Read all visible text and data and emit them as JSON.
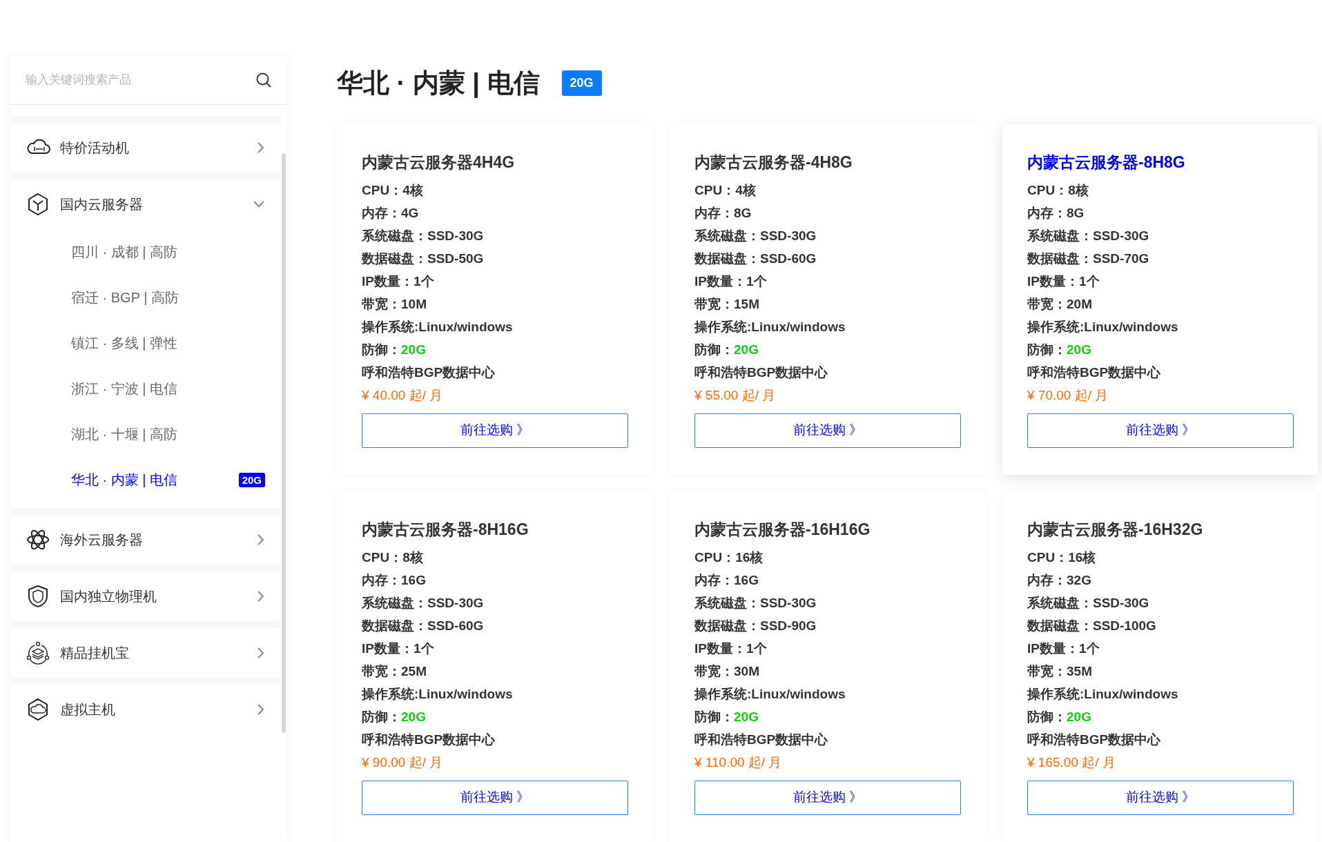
{
  "sidebar": {
    "search": {
      "placeholder": "输入关键词搜索产品"
    },
    "categories": [
      {
        "label": "特价活动机",
        "expanded": false
      },
      {
        "label": "国内云服务器",
        "expanded": true,
        "children": [
          {
            "label": "四川 · 成都 | 高防",
            "selected": false
          },
          {
            "label": "宿迁 · BGP | 高防",
            "selected": false
          },
          {
            "label": "镇江 · 多线 | 弹性",
            "selected": false
          },
          {
            "label": "浙江 · 宁波 | 电信",
            "selected": false
          },
          {
            "label": "湖北 · 十堰 | 高防",
            "selected": false
          },
          {
            "label": "华北 · 内蒙 | 电信",
            "selected": true,
            "badge": "20G"
          }
        ]
      },
      {
        "label": "海外云服务器",
        "expanded": false
      },
      {
        "label": "国内独立物理机",
        "expanded": false
      },
      {
        "label": "精品挂机宝",
        "expanded": false
      },
      {
        "label": "虚拟主机",
        "expanded": false
      }
    ]
  },
  "heading": {
    "title": "华北 · 内蒙 | 电信",
    "badge": "20G"
  },
  "products": [
    {
      "name": "内蒙古云服务器4H4G",
      "highlighted": false,
      "specs": [
        {
          "label": "CPU：",
          "value": "4核"
        },
        {
          "label": "内存：",
          "value": "4G"
        },
        {
          "label": "系统磁盘：",
          "value": "SSD-30G"
        },
        {
          "label": "数据磁盘：",
          "value": "SSD-50G"
        },
        {
          "label": "IP数量：",
          "value": "1个"
        },
        {
          "label": "带宽：",
          "value": "10M"
        },
        {
          "label": "操作系统:",
          "value": "Linux/windows"
        },
        {
          "label": "防御：",
          "value": "20G",
          "accent": true
        },
        {
          "label": "呼和浩特BGP数据中心"
        }
      ],
      "price": "¥ 40.00 起/ 月",
      "button": "前往选购 》"
    },
    {
      "name": "内蒙古云服务器-4H8G",
      "highlighted": false,
      "specs": [
        {
          "label": "CPU：",
          "value": "4核"
        },
        {
          "label": "内存：",
          "value": "8G"
        },
        {
          "label": "系统磁盘：",
          "value": "SSD-30G"
        },
        {
          "label": "数据磁盘：",
          "value": "SSD-60G"
        },
        {
          "label": "IP数量：",
          "value": "1个"
        },
        {
          "label": "带宽：",
          "value": "15M"
        },
        {
          "label": "操作系统:",
          "value": "Linux/windows"
        },
        {
          "label": "防御：",
          "value": "20G",
          "accent": true
        },
        {
          "label": "呼和浩特BGP数据中心"
        }
      ],
      "price": "¥ 55.00 起/ 月",
      "button": "前往选购 》"
    },
    {
      "name": "内蒙古云服务器-8H8G",
      "highlighted": true,
      "specs": [
        {
          "label": "CPU：",
          "value": "8核"
        },
        {
          "label": "内存：",
          "value": "8G"
        },
        {
          "label": "系统磁盘：",
          "value": "SSD-30G"
        },
        {
          "label": "数据磁盘：",
          "value": "SSD-70G"
        },
        {
          "label": "IP数量：",
          "value": "1个"
        },
        {
          "label": "带宽：",
          "value": "20M"
        },
        {
          "label": "操作系统:",
          "value": "Linux/windows"
        },
        {
          "label": "防御：",
          "value": "20G",
          "accent": true
        },
        {
          "label": "呼和浩特BGP数据中心"
        }
      ],
      "price": "¥ 70.00 起/ 月",
      "button": "前往选购 》"
    },
    {
      "name": "内蒙古云服务器-8H16G",
      "highlighted": false,
      "specs": [
        {
          "label": "CPU：",
          "value": "8核"
        },
        {
          "label": "内存：",
          "value": "16G"
        },
        {
          "label": "系统磁盘：",
          "value": "SSD-30G"
        },
        {
          "label": "数据磁盘：",
          "value": "SSD-60G"
        },
        {
          "label": "IP数量：",
          "value": "1个"
        },
        {
          "label": "带宽：",
          "value": "25M"
        },
        {
          "label": "操作系统:",
          "value": "Linux/windows"
        },
        {
          "label": "防御：",
          "value": "20G",
          "accent": true
        },
        {
          "label": "呼和浩特BGP数据中心"
        }
      ],
      "price": "¥ 90.00 起/ 月",
      "button": "前往选购 》"
    },
    {
      "name": "内蒙古云服务器-16H16G",
      "highlighted": false,
      "specs": [
        {
          "label": "CPU：",
          "value": "16核"
        },
        {
          "label": "内存：",
          "value": "16G"
        },
        {
          "label": "系统磁盘：",
          "value": "SSD-30G"
        },
        {
          "label": "数据磁盘：",
          "value": "SSD-90G"
        },
        {
          "label": "IP数量：",
          "value": "1个"
        },
        {
          "label": "带宽：",
          "value": "30M"
        },
        {
          "label": "操作系统:",
          "value": "Linux/windows"
        },
        {
          "label": "防御：",
          "value": "20G",
          "accent": true
        },
        {
          "label": "呼和浩特BGP数据中心"
        }
      ],
      "price": "¥ 110.00 起/ 月",
      "button": "前往选购 》"
    },
    {
      "name": "内蒙古云服务器-16H32G",
      "highlighted": false,
      "specs": [
        {
          "label": "CPU：",
          "value": "16核"
        },
        {
          "label": "内存：",
          "value": "32G"
        },
        {
          "label": "系统磁盘：",
          "value": "SSD-30G"
        },
        {
          "label": "数据磁盘：",
          "value": "SSD-100G"
        },
        {
          "label": "IP数量：",
          "value": "1个"
        },
        {
          "label": "带宽：",
          "value": "35M"
        },
        {
          "label": "操作系统:",
          "value": "Linux/windows"
        },
        {
          "label": "防御：",
          "value": "20G",
          "accent": true
        },
        {
          "label": "呼和浩特BGP数据中心"
        }
      ],
      "price": "¥ 165.00 起/ 月",
      "button": "前往选购 》"
    }
  ]
}
